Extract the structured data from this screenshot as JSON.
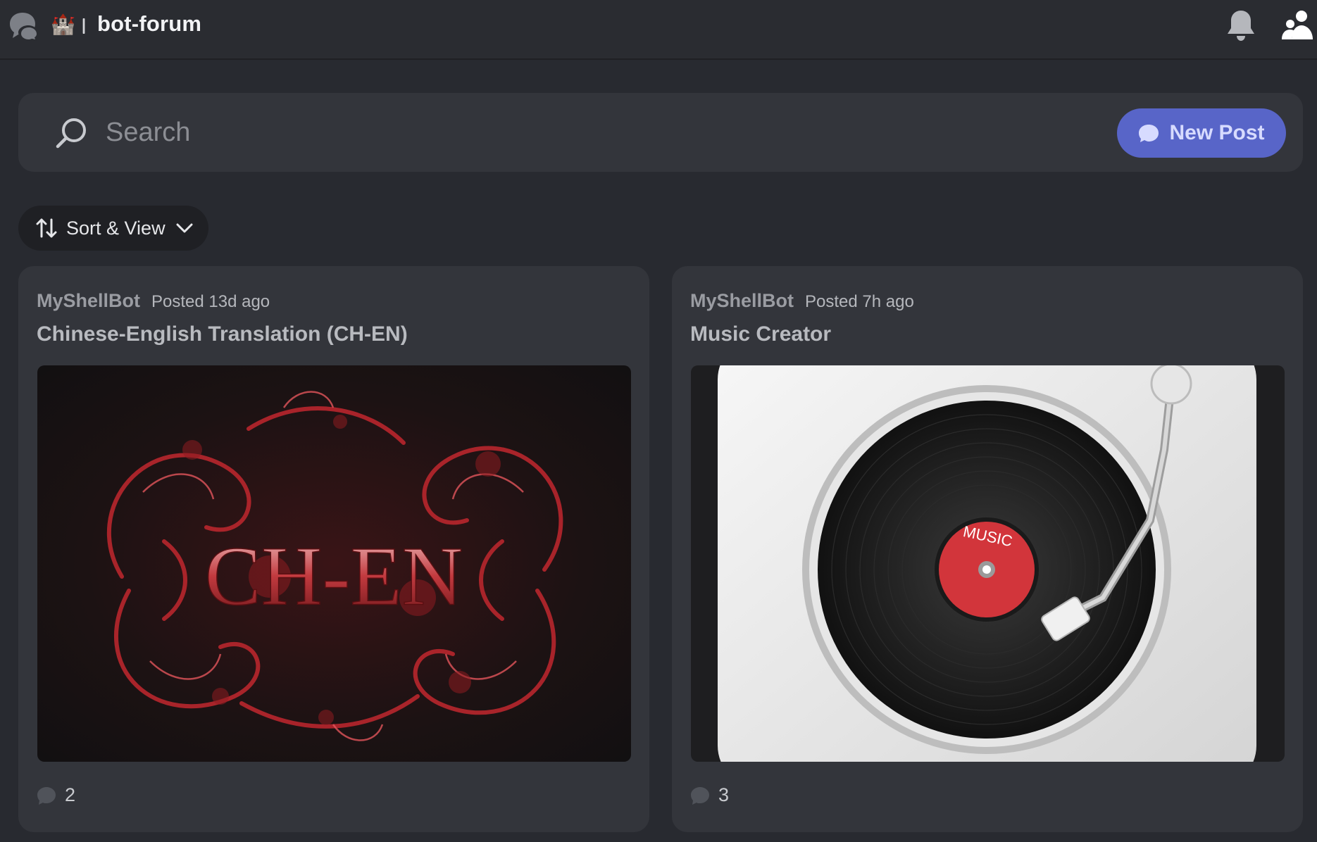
{
  "header": {
    "channel_name": "bot-forum",
    "castle_glyph": "🏰",
    "icons": [
      "forum-icon",
      "castle-icon",
      "bell-icon",
      "members-icon"
    ]
  },
  "search": {
    "placeholder": "Search",
    "value": ""
  },
  "toolbar": {
    "new_post_label": "New Post",
    "sort_label": "Sort & View"
  },
  "posts": [
    {
      "author": "MyShellBot",
      "posted": "Posted 13d ago",
      "title": "Chinese-English Translation (CH-EN)",
      "thumbnail_text": "CH-EN",
      "reply_count": "2"
    },
    {
      "author": "MyShellBot",
      "posted": "Posted 7h ago",
      "title": "Music Creator",
      "thumbnail_text": "MUSIC",
      "reply_count": "3"
    }
  ],
  "colors": {
    "background": "#282a30",
    "card": "#33353b",
    "accent": "#5865c8",
    "thumb_red": "#c0353c"
  }
}
